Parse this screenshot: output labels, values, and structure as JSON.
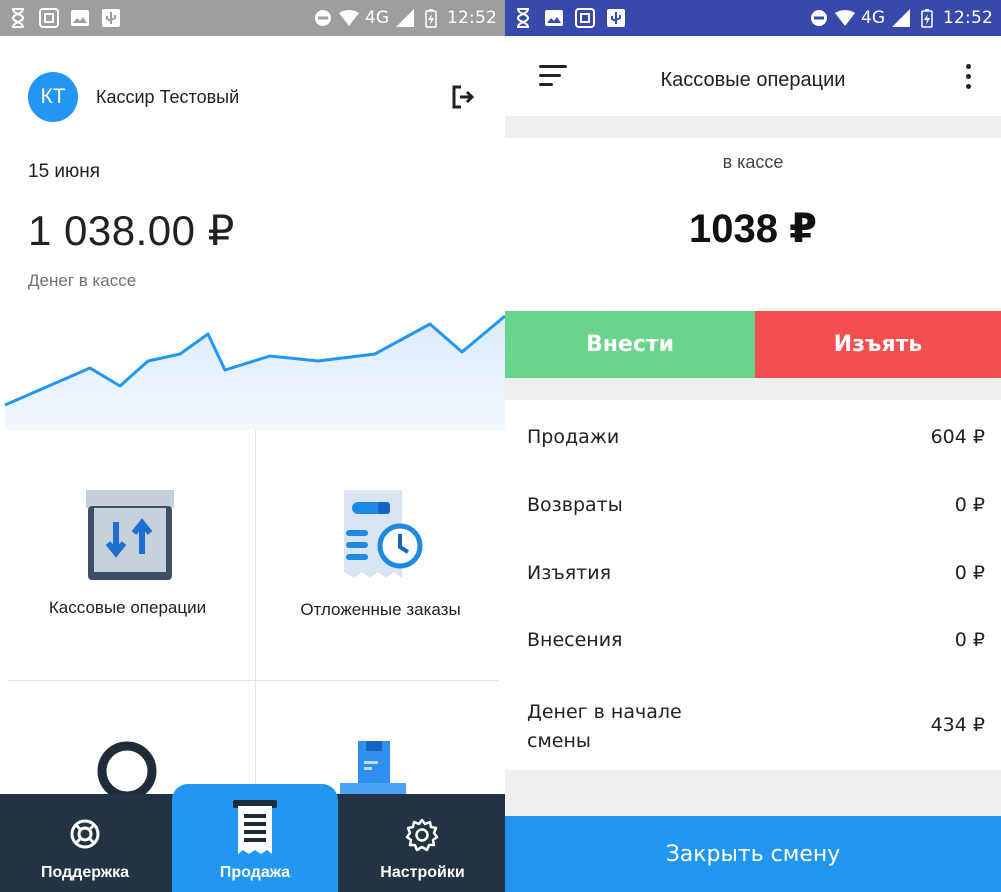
{
  "left_screen": {
    "status_bar": {
      "network": "4G",
      "time": "12:52"
    },
    "profile": {
      "initials": "КТ",
      "name": "Кассир Тестовый",
      "logout_icon": "logout-icon"
    },
    "date": "15 июня",
    "cash_amount": "1 038.00 ₽",
    "cash_caption": "Денег в кассе",
    "tiles": [
      {
        "label": "Кассовые операции",
        "icon": "cash-operations-icon"
      },
      {
        "label": "Отложенные заказы",
        "icon": "deferred-orders-icon"
      }
    ],
    "bottom_nav": {
      "items": [
        {
          "label": "Поддержка",
          "icon": "lifebuoy-icon"
        },
        {
          "label": "Продажа",
          "icon": "receipt-icon",
          "active": true
        },
        {
          "label": "Настройки",
          "icon": "gear-icon"
        }
      ]
    },
    "colors": {
      "accent": "#2196f3",
      "nav_bg": "#223344",
      "status_bar": "#9e9e9e"
    }
  },
  "right_screen": {
    "status_bar": {
      "network": "4G",
      "time": "12:52"
    },
    "toolbar": {
      "title": "Кассовые операции"
    },
    "in_cash_label": "в кассе",
    "in_cash_amount": "1038 ₽",
    "buttons": {
      "deposit": "Внести",
      "withdraw": "Изъять"
    },
    "summary": [
      {
        "label": "Продажи",
        "value": "604 ₽"
      },
      {
        "label": "Возвраты",
        "value": "0 ₽"
      },
      {
        "label": "Изъятия",
        "value": "0 ₽"
      },
      {
        "label": "Внесения",
        "value": "0 ₽"
      },
      {
        "label": "Денег в начале смены",
        "value": "434 ₽"
      }
    ],
    "close_shift": "Закрыть смену",
    "colors": {
      "deposit": "#6ad38c",
      "withdraw": "#f44e4e",
      "primary": "#2196f3",
      "status_bar": "#3949ab"
    }
  }
}
